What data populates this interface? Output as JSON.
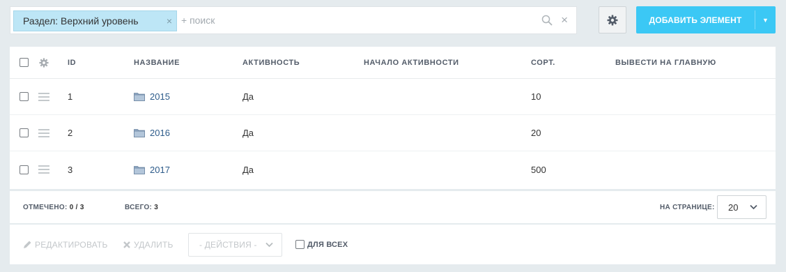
{
  "filter": {
    "tag_label": "Раздел: Верхний уровень",
    "add_placeholder": "+ поиск",
    "tag_close": "×",
    "clear": "×"
  },
  "toolbar": {
    "add_button": "ДОБАВИТЬ ЭЛЕМЕНТ",
    "add_arrow": "▼",
    "accent_color": "#3bc8f5"
  },
  "grid": {
    "columns": {
      "id": "ID",
      "name": "НАЗВАНИЕ",
      "active": "АКТИВНОСТЬ",
      "active_from": "НАЧАЛО АКТИВНОСТИ",
      "sort": "СОРТ.",
      "show_on_main": "ВЫВЕСТИ НА ГЛАВНУЮ"
    },
    "rows": [
      {
        "id": "1",
        "name": "2015",
        "active": "Да",
        "sort": "10"
      },
      {
        "id": "2",
        "name": "2016",
        "active": "Да",
        "sort": "20"
      },
      {
        "id": "3",
        "name": "2017",
        "active": "Да",
        "sort": "500"
      }
    ]
  },
  "footer": {
    "selected_label": "ОТМЕЧЕНО:",
    "selected_value": "0 / 3",
    "total_label": "ВСЕГО:",
    "total_value": "3",
    "per_page_label": "НА СТРАНИЦЕ:",
    "per_page_value": "20"
  },
  "actions": {
    "edit": "РЕДАКТИРОВАТЬ",
    "delete": "УДАЛИТЬ",
    "actions_select": "- ДЕЙСТВИЯ -",
    "for_all": "ДЛЯ ВСЕХ"
  }
}
